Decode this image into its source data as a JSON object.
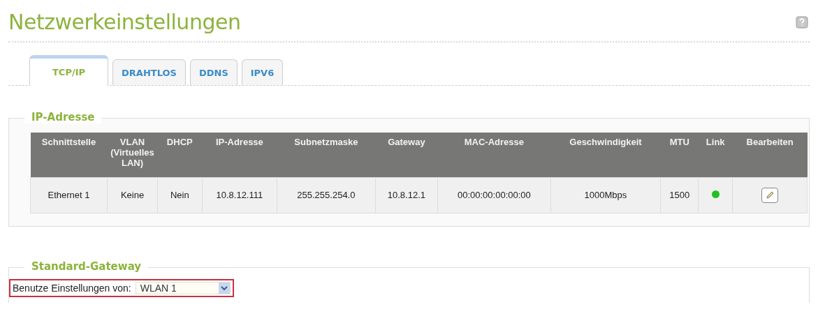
{
  "title": "Netzwerkeinstellungen",
  "tabs": [
    {
      "label": "TCP/IP",
      "selected": true
    },
    {
      "label": "DRAHTLOS",
      "selected": false
    },
    {
      "label": "DDNS",
      "selected": false
    },
    {
      "label": "IPV6",
      "selected": false
    }
  ],
  "ip_section": {
    "legend": "IP-Adresse",
    "columns": [
      "Schnittstelle",
      "VLAN (Virtuelles LAN)",
      "DHCP",
      "IP-Adresse",
      "Subnetzmaske",
      "Gateway",
      "MAC-Adresse",
      "Geschwindigkeit",
      "MTU",
      "Link",
      "Bearbeiten"
    ],
    "rows": [
      {
        "cells": [
          "Ethernet 1",
          "Keine",
          "Nein",
          "10.8.12.111",
          "255.255.254.0",
          "10.8.12.1",
          "00:00:00:00:00:00",
          "1000Mbps",
          "1500"
        ],
        "link_up": true
      }
    ]
  },
  "gateway_section": {
    "legend": "Standard-Gateway",
    "label": "Benutze Einstellungen von:",
    "value": "WLAN 1",
    "highlighted": true
  }
}
